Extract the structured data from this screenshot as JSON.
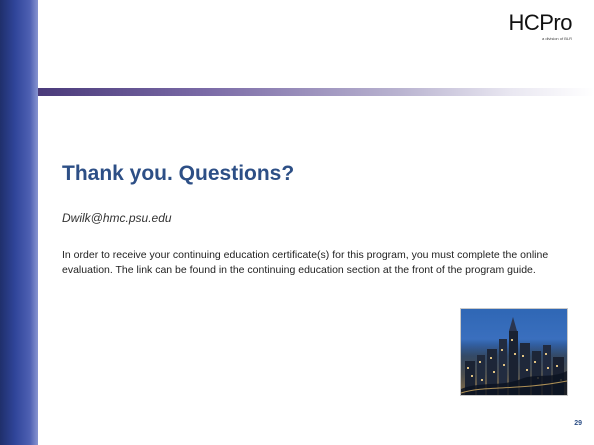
{
  "logo": {
    "text": "HCPro",
    "sub": "a division of BLR"
  },
  "slide": {
    "title": "Thank you. Questions?",
    "email": "Dwilk@hmc.psu.edu",
    "body": "In order to receive your continuing education certificate(s) for this program, you must complete the online evaluation. The link can be found in the continuing education section at the front of the program guide.",
    "page_number": "29"
  },
  "colors": {
    "accent": "#2d4f86",
    "sidebar": "#30459a"
  },
  "image": {
    "name": "city-skyline-photo"
  }
}
